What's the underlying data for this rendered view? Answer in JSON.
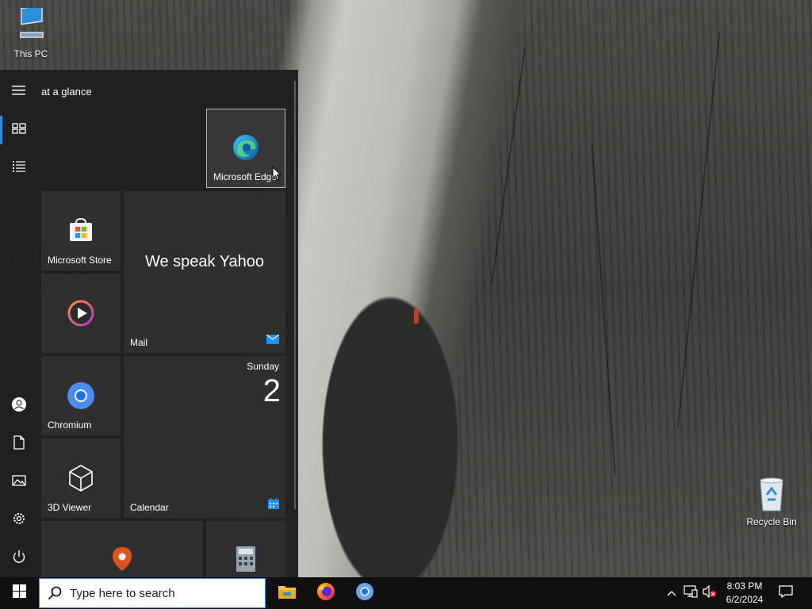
{
  "desktop": {
    "icons": [
      {
        "label": "This PC",
        "icon": "computer-icon"
      },
      {
        "label": "Recycle Bin",
        "icon": "recycle-bin-icon"
      }
    ]
  },
  "start_menu": {
    "group_title": "at a glance",
    "rail": {
      "top": [
        "hamburger-menu-icon",
        "tiles-view-icon",
        "all-apps-list-icon"
      ],
      "bottom": [
        "user-account-icon",
        "documents-icon",
        "pictures-icon",
        "settings-icon",
        "power-icon"
      ]
    },
    "tiles": {
      "edge": "Microsoft Edge",
      "store": "Microsoft Store",
      "media": "",
      "mail_headline": "We speak Yahoo",
      "mail": "Mail",
      "chromium": "Chromium",
      "calendar_day": "Sunday",
      "calendar_date": "2",
      "calendar": "Calendar",
      "viewer3d": "3D Viewer",
      "maps": "",
      "calculator": ""
    }
  },
  "taskbar": {
    "search_placeholder": "Type here to search",
    "pinned_apps": [
      "file-explorer-icon",
      "firefox-icon",
      "chromium-icon"
    ],
    "clock_time": "8:03 PM",
    "clock_date": "6/2/2024"
  },
  "colors": {
    "accent": "#2d8ae0",
    "tile": "#2f2f2f",
    "start_bg": "#1f1f1f",
    "taskbar_bg": "#101010"
  }
}
